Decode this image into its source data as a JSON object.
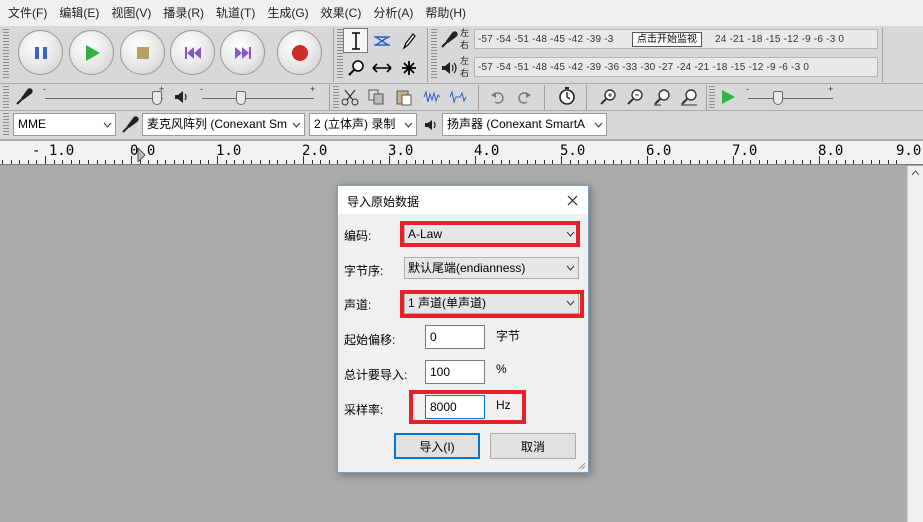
{
  "menu": [
    "文件(F)",
    "编辑(E)",
    "视图(V)",
    "播录(R)",
    "轨道(T)",
    "生成(G)",
    "效果(C)",
    "分析(A)",
    "帮助(H)"
  ],
  "meters": {
    "record_scale": "-57 -54 -51 -48 -45 -42 -39 -3",
    "record_scale_tail": "24 -21 -18 -15 -12  -9  -6  -3  0",
    "record_hint": "点击开始监视",
    "play_scale": "-57 -54 -51 -48 -45 -42 -39 -36 -33 -30 -27 -24 -21 -18 -15 -12  -9  -6  -3  0",
    "left": "左",
    "right": "右"
  },
  "sliders": {
    "record_volume_pct": 95,
    "play_volume_pct": 35,
    "play_speed_pct": 35
  },
  "device": {
    "host": "MME",
    "input": "麦克风阵列 (Conexant Sm",
    "channels": "2 (立体声) 录制",
    "output": "扬声器 (Conexant SmartA"
  },
  "ruler": {
    "labels": [
      "- 1.0",
      "0.0",
      "1.0",
      "2.0",
      "3.0",
      "4.0",
      "5.0",
      "6.0",
      "7.0",
      "8.0",
      "9.0"
    ]
  },
  "dialog": {
    "title": "导入原始数据",
    "encoding_label": "编码:",
    "encoding_value": "A-Law",
    "byte_order_label": "字节序:",
    "byte_order_value": "默认尾端(endianness)",
    "channels_label": "声道:",
    "channels_value": "1 声道(单声道)",
    "offset_label": "起始偏移:",
    "offset_value": "0",
    "offset_unit": "字节",
    "amount_label": "总计要导入:",
    "amount_value": "100",
    "amount_unit": "%",
    "rate_label": "采样率:",
    "rate_value": "8000",
    "rate_unit": "Hz",
    "import_button": "导入(I)",
    "cancel_button": "取消"
  },
  "colors": {
    "highlight": "#e8202a",
    "play_green": "#2fb344",
    "record_red": "#d12c2c",
    "pause_blue": "#3b62c7",
    "skip_purple": "#8a55c9"
  },
  "icons": [
    "pause-icon",
    "play-icon",
    "stop-icon",
    "skip-start-icon",
    "skip-end-icon",
    "record-icon",
    "select-tool-icon",
    "envelope-tool-icon",
    "draw-tool-icon",
    "zoom-tool-icon",
    "timeshift-tool-icon",
    "multi-tool-icon",
    "microphone-icon",
    "speaker-icon",
    "close-icon"
  ]
}
